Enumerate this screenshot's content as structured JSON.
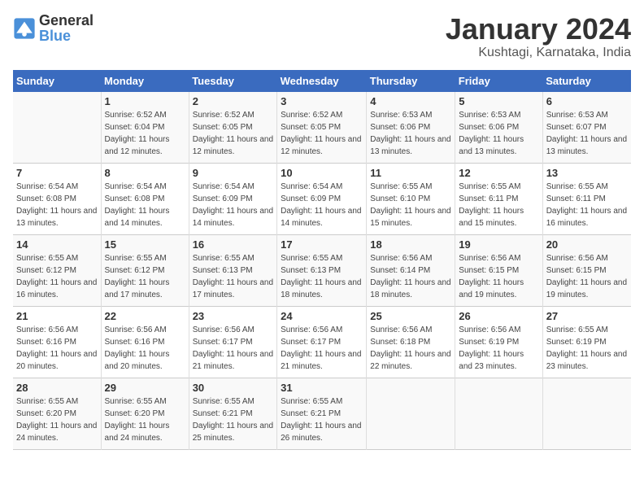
{
  "header": {
    "logo_general": "General",
    "logo_blue": "Blue",
    "month": "January 2024",
    "location": "Kushtagi, Karnataka, India"
  },
  "calendar": {
    "days_of_week": [
      "Sunday",
      "Monday",
      "Tuesday",
      "Wednesday",
      "Thursday",
      "Friday",
      "Saturday"
    ],
    "weeks": [
      [
        {
          "day": "",
          "info": ""
        },
        {
          "day": "1",
          "info": "Sunrise: 6:52 AM\nSunset: 6:04 PM\nDaylight: 11 hours and 12 minutes."
        },
        {
          "day": "2",
          "info": "Sunrise: 6:52 AM\nSunset: 6:05 PM\nDaylight: 11 hours and 12 minutes."
        },
        {
          "day": "3",
          "info": "Sunrise: 6:52 AM\nSunset: 6:05 PM\nDaylight: 11 hours and 12 minutes."
        },
        {
          "day": "4",
          "info": "Sunrise: 6:53 AM\nSunset: 6:06 PM\nDaylight: 11 hours and 13 minutes."
        },
        {
          "day": "5",
          "info": "Sunrise: 6:53 AM\nSunset: 6:06 PM\nDaylight: 11 hours and 13 minutes."
        },
        {
          "day": "6",
          "info": "Sunrise: 6:53 AM\nSunset: 6:07 PM\nDaylight: 11 hours and 13 minutes."
        }
      ],
      [
        {
          "day": "7",
          "info": "Sunrise: 6:54 AM\nSunset: 6:08 PM\nDaylight: 11 hours and 13 minutes."
        },
        {
          "day": "8",
          "info": "Sunrise: 6:54 AM\nSunset: 6:08 PM\nDaylight: 11 hours and 14 minutes."
        },
        {
          "day": "9",
          "info": "Sunrise: 6:54 AM\nSunset: 6:09 PM\nDaylight: 11 hours and 14 minutes."
        },
        {
          "day": "10",
          "info": "Sunrise: 6:54 AM\nSunset: 6:09 PM\nDaylight: 11 hours and 14 minutes."
        },
        {
          "day": "11",
          "info": "Sunrise: 6:55 AM\nSunset: 6:10 PM\nDaylight: 11 hours and 15 minutes."
        },
        {
          "day": "12",
          "info": "Sunrise: 6:55 AM\nSunset: 6:11 PM\nDaylight: 11 hours and 15 minutes."
        },
        {
          "day": "13",
          "info": "Sunrise: 6:55 AM\nSunset: 6:11 PM\nDaylight: 11 hours and 16 minutes."
        }
      ],
      [
        {
          "day": "14",
          "info": "Sunrise: 6:55 AM\nSunset: 6:12 PM\nDaylight: 11 hours and 16 minutes."
        },
        {
          "day": "15",
          "info": "Sunrise: 6:55 AM\nSunset: 6:12 PM\nDaylight: 11 hours and 17 minutes."
        },
        {
          "day": "16",
          "info": "Sunrise: 6:55 AM\nSunset: 6:13 PM\nDaylight: 11 hours and 17 minutes."
        },
        {
          "day": "17",
          "info": "Sunrise: 6:55 AM\nSunset: 6:13 PM\nDaylight: 11 hours and 18 minutes."
        },
        {
          "day": "18",
          "info": "Sunrise: 6:56 AM\nSunset: 6:14 PM\nDaylight: 11 hours and 18 minutes."
        },
        {
          "day": "19",
          "info": "Sunrise: 6:56 AM\nSunset: 6:15 PM\nDaylight: 11 hours and 19 minutes."
        },
        {
          "day": "20",
          "info": "Sunrise: 6:56 AM\nSunset: 6:15 PM\nDaylight: 11 hours and 19 minutes."
        }
      ],
      [
        {
          "day": "21",
          "info": "Sunrise: 6:56 AM\nSunset: 6:16 PM\nDaylight: 11 hours and 20 minutes."
        },
        {
          "day": "22",
          "info": "Sunrise: 6:56 AM\nSunset: 6:16 PM\nDaylight: 11 hours and 20 minutes."
        },
        {
          "day": "23",
          "info": "Sunrise: 6:56 AM\nSunset: 6:17 PM\nDaylight: 11 hours and 21 minutes."
        },
        {
          "day": "24",
          "info": "Sunrise: 6:56 AM\nSunset: 6:17 PM\nDaylight: 11 hours and 21 minutes."
        },
        {
          "day": "25",
          "info": "Sunrise: 6:56 AM\nSunset: 6:18 PM\nDaylight: 11 hours and 22 minutes."
        },
        {
          "day": "26",
          "info": "Sunrise: 6:56 AM\nSunset: 6:19 PM\nDaylight: 11 hours and 23 minutes."
        },
        {
          "day": "27",
          "info": "Sunrise: 6:55 AM\nSunset: 6:19 PM\nDaylight: 11 hours and 23 minutes."
        }
      ],
      [
        {
          "day": "28",
          "info": "Sunrise: 6:55 AM\nSunset: 6:20 PM\nDaylight: 11 hours and 24 minutes."
        },
        {
          "day": "29",
          "info": "Sunrise: 6:55 AM\nSunset: 6:20 PM\nDaylight: 11 hours and 24 minutes."
        },
        {
          "day": "30",
          "info": "Sunrise: 6:55 AM\nSunset: 6:21 PM\nDaylight: 11 hours and 25 minutes."
        },
        {
          "day": "31",
          "info": "Sunrise: 6:55 AM\nSunset: 6:21 PM\nDaylight: 11 hours and 26 minutes."
        },
        {
          "day": "",
          "info": ""
        },
        {
          "day": "",
          "info": ""
        },
        {
          "day": "",
          "info": ""
        }
      ]
    ]
  }
}
